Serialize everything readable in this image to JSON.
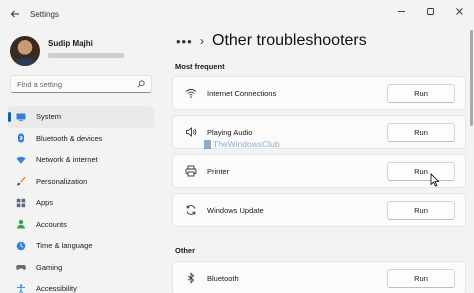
{
  "window": {
    "app_title": "Settings"
  },
  "profile": {
    "name": "Sudip Majhi"
  },
  "search": {
    "placeholder": "Find a setting"
  },
  "sidebar": {
    "items": [
      {
        "label": "System",
        "icon": "monitor-icon",
        "active": true
      },
      {
        "label": "Bluetooth & devices",
        "icon": "bluetooth-icon"
      },
      {
        "label": "Network & internet",
        "icon": "wifi-icon"
      },
      {
        "label": "Personalization",
        "icon": "brush-icon"
      },
      {
        "label": "Apps",
        "icon": "apps-icon"
      },
      {
        "label": "Accounts",
        "icon": "person-icon"
      },
      {
        "label": "Time & language",
        "icon": "clock-icon"
      },
      {
        "label": "Gaming",
        "icon": "gamepad-icon"
      },
      {
        "label": "Accessibility",
        "icon": "accessibility-icon"
      }
    ]
  },
  "main": {
    "breadcrumb_more": "•••",
    "breadcrumb_sep": "›",
    "title": "Other troubleshooters",
    "sections": {
      "most_frequent": "Most frequent",
      "other": "Other"
    },
    "troubleshooters": [
      {
        "label": "Internet Connections",
        "icon": "wifi-icon",
        "button": "Run"
      },
      {
        "label": "Playing Audio",
        "icon": "speaker-icon",
        "button": "Run"
      },
      {
        "label": "Printer",
        "icon": "printer-icon",
        "button": "Run"
      },
      {
        "label": "Windows Update",
        "icon": "sync-icon",
        "button": "Run"
      },
      {
        "label": "Bluetooth",
        "icon": "bluetooth-icon",
        "button": "Run"
      }
    ],
    "watermark": "TheWindowsClub"
  },
  "colors": {
    "accent": "#0067c0",
    "background": "#f3f3f3",
    "card": "#fbfbfb"
  }
}
